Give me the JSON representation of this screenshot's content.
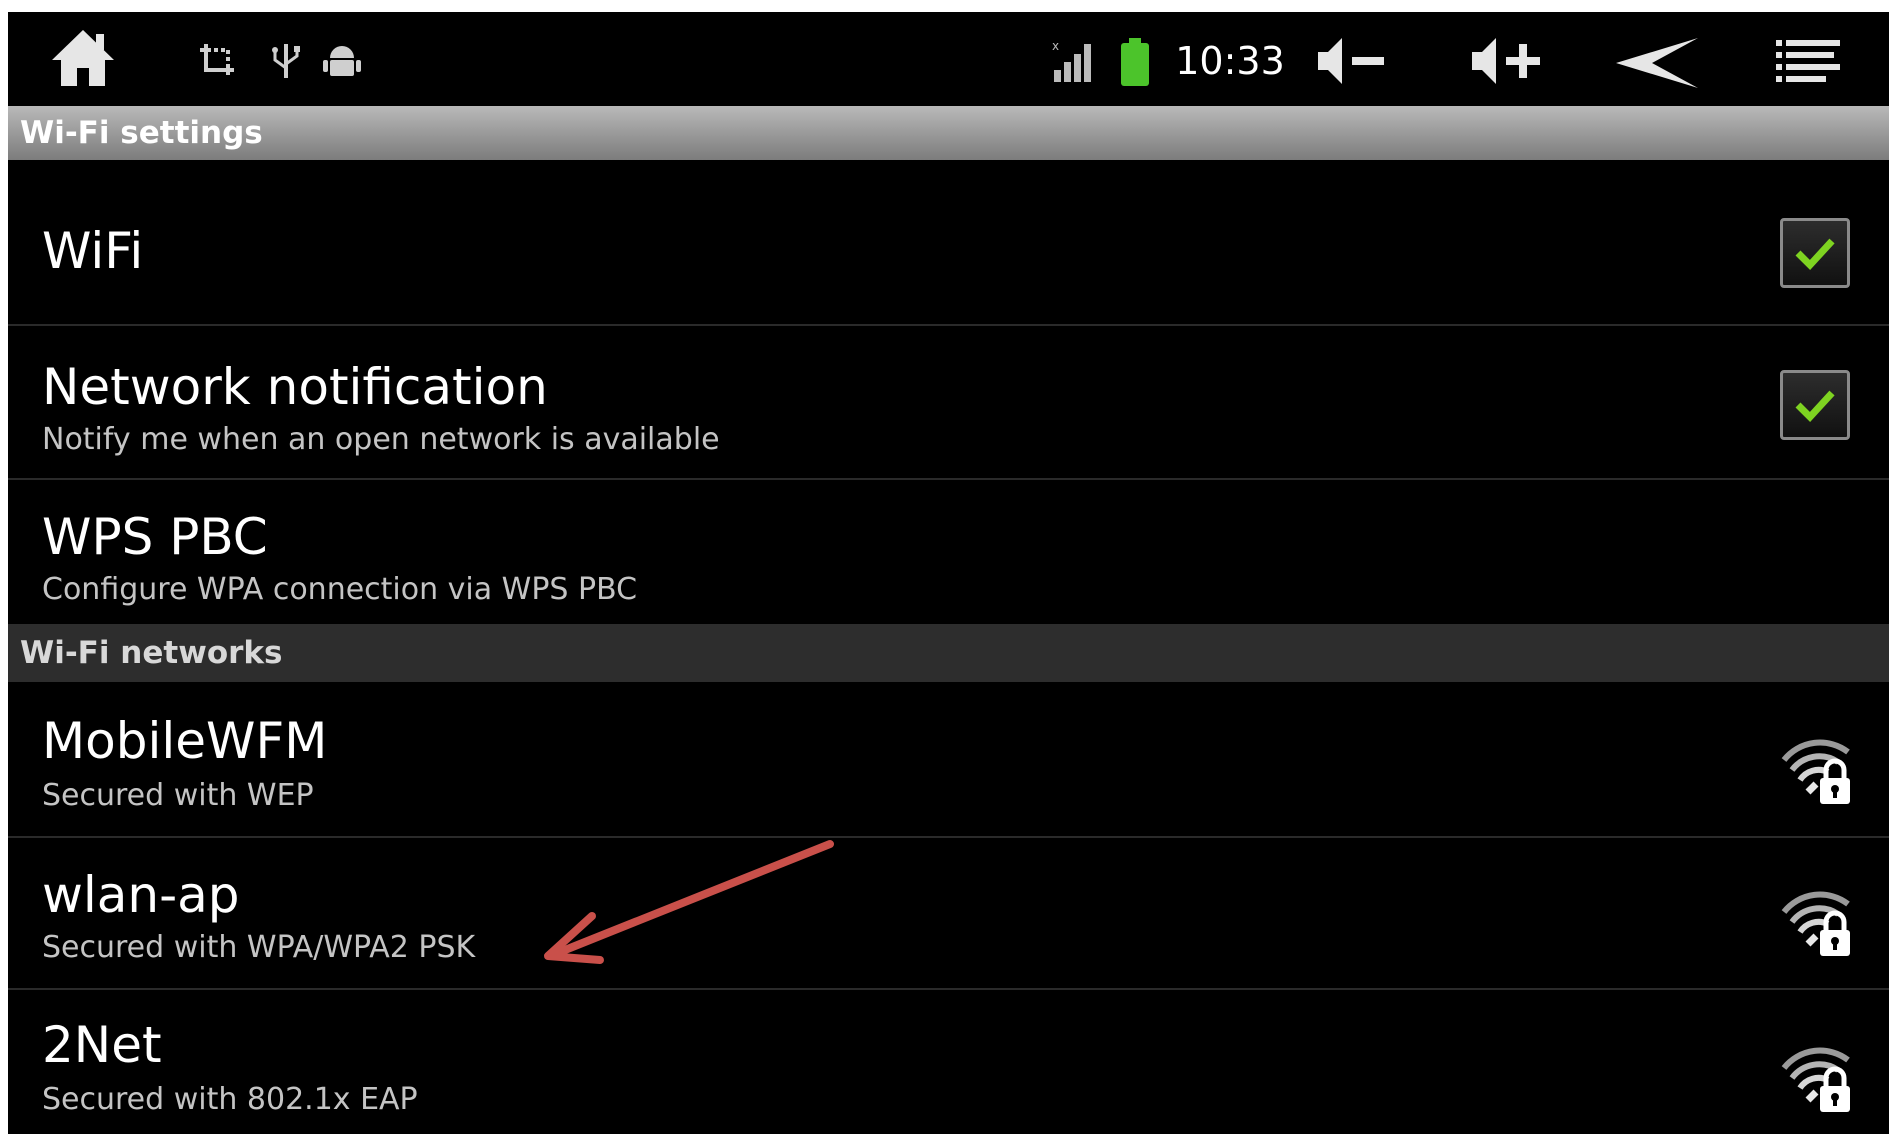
{
  "status_bar": {
    "clock": "10:33",
    "icons": [
      "home-icon",
      "screenshot-icon",
      "usb-icon",
      "android-debug-icon",
      "signal-icon",
      "battery-icon",
      "volume-down-icon",
      "volume-up-icon",
      "back-icon",
      "menu-icon"
    ],
    "battery_color": "#4cc42b"
  },
  "wifi_settings": {
    "header": "Wi-Fi settings",
    "items": [
      {
        "title": "WiFi",
        "checked": true
      },
      {
        "title": "Network notification",
        "subtitle": "Notify me when an open network is available",
        "checked": true
      },
      {
        "title": "WPS PBC",
        "subtitle": "Configure WPA connection via WPS PBC"
      }
    ]
  },
  "wifi_networks": {
    "header": "Wi-Fi networks",
    "items": [
      {
        "ssid": "MobileWFM",
        "security": "Secured with WEP",
        "icon": "wifi-locked-icon"
      },
      {
        "ssid": "wlan-ap",
        "security": "Secured with WPA/WPA2 PSK",
        "icon": "wifi-locked-icon"
      },
      {
        "ssid": "2Net",
        "security": "Secured with 802.1x EAP",
        "icon": "wifi-locked-icon"
      }
    ]
  },
  "colors": {
    "check_mark": "#7ed321",
    "annotation_arrow": "#c9504a"
  }
}
